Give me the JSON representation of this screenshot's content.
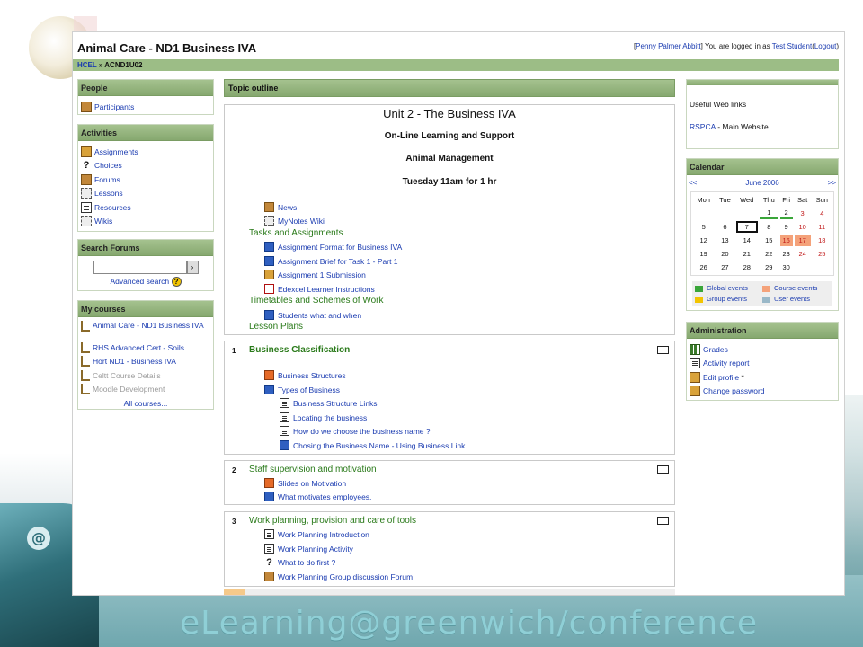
{
  "site": {
    "title": "Animal Care - ND1 Business IVA",
    "login": {
      "teacher": "Penny Palmer Abbitt",
      "prefix": "You are logged in as",
      "user": "Test Student",
      "logout": "Logout"
    },
    "breadcrumb": {
      "root": "HCEL",
      "sep": "»",
      "current": "ACND1U02"
    }
  },
  "people": {
    "title": "People",
    "items": [
      {
        "label": "Participants",
        "icon": "people-icon"
      }
    ]
  },
  "activities": {
    "title": "Activities",
    "items": [
      {
        "label": "Assignments",
        "icon": "assignment-icon"
      },
      {
        "label": "Choices",
        "icon": "question-icon"
      },
      {
        "label": "Forums",
        "icon": "forum-icon"
      },
      {
        "label": "Lessons",
        "icon": "lesson-icon"
      },
      {
        "label": "Resources",
        "icon": "resource-icon"
      },
      {
        "label": "Wikis",
        "icon": "wiki-icon"
      }
    ]
  },
  "search": {
    "title": "Search Forums",
    "button": "›",
    "advanced": "Advanced search",
    "help": "?"
  },
  "mycourses": {
    "title": "My courses",
    "items": [
      {
        "label": "Animal Care - ND1 Business IVA",
        "dim": false
      },
      {
        "label": "RHS Advanced Cert - Soils",
        "dim": false
      },
      {
        "label": "Hort ND1 - Business IVA",
        "dim": false
      },
      {
        "label": "Celtt Course Details",
        "dim": true
      },
      {
        "label": "Moodle Development",
        "dim": true
      }
    ],
    "all": "All courses..."
  },
  "topic_outline": "Topic outline",
  "section0": {
    "unit": "Unit 2  - The Business IVA",
    "line1": "On-Line Learning and Support",
    "line2": "Animal Management",
    "line3": "Tuesday  11am for 1 hr",
    "news": "News",
    "wiki": "MyNotes Wiki",
    "label_tasks": "Tasks and Assignments",
    "tasks": [
      "Assignment Format for Business IVA",
      "Assignment Brief for Task 1 - Part 1",
      "Assignment 1 Submission",
      "Edexcel Learner Instructions"
    ],
    "label_timetables": "Timetables and Schemes of Work",
    "timetable_item": "Students what and when",
    "label_lessons": "Lesson Plans"
  },
  "section1": {
    "num": "1",
    "title": "Business Classification",
    "items": [
      "Business Structures",
      "Types of Business",
      "Business Structure Links",
      "Locating the business",
      "How do we choose the business name ?",
      "Chosing the Business Name - Using Business Link."
    ]
  },
  "section2": {
    "num": "2",
    "title": "Staff supervision and motivation",
    "items": [
      "Slides on Motivation",
      "What motivates employees."
    ]
  },
  "section3": {
    "num": "3",
    "title": "Work planning, provision and care of tools",
    "items": [
      "Work Planning Introduction",
      "Work Planning Activity",
      "What to do first ?",
      "Work Planning Group discussion Forum"
    ]
  },
  "weblinks": {
    "text": "Useful Web links",
    "link": "RSPCA",
    "suffix": " - Main Website"
  },
  "calendar": {
    "title": "Calendar",
    "prev": "<<",
    "month": "June 2006",
    "next": ">>",
    "days": [
      "Mon",
      "Tue",
      "Wed",
      "Thu",
      "Fri",
      "Sat",
      "Sun"
    ],
    "weeks": [
      [
        "",
        "",
        "",
        "1",
        "2",
        "3",
        "4"
      ],
      [
        "5",
        "6",
        "7",
        "8",
        "9",
        "10",
        "11"
      ],
      [
        "12",
        "13",
        "14",
        "15",
        "16",
        "17",
        "18"
      ],
      [
        "19",
        "20",
        "21",
        "22",
        "23",
        "24",
        "25"
      ],
      [
        "26",
        "27",
        "28",
        "29",
        "30",
        "",
        ""
      ]
    ],
    "key": {
      "global": "Global events",
      "course": "Course events",
      "group": "Group events",
      "user": "User events"
    },
    "colors": {
      "global": "#3aa63a",
      "course": "#f4a27a",
      "group": "#f2c400",
      "user": "#9ab8c8"
    }
  },
  "admin": {
    "title": "Administration",
    "items": [
      "Grades",
      "Activity report",
      "Edit profile",
      "Change password"
    ],
    "edit_mark": "*"
  },
  "banner": "eLearning@greenwich/conference"
}
